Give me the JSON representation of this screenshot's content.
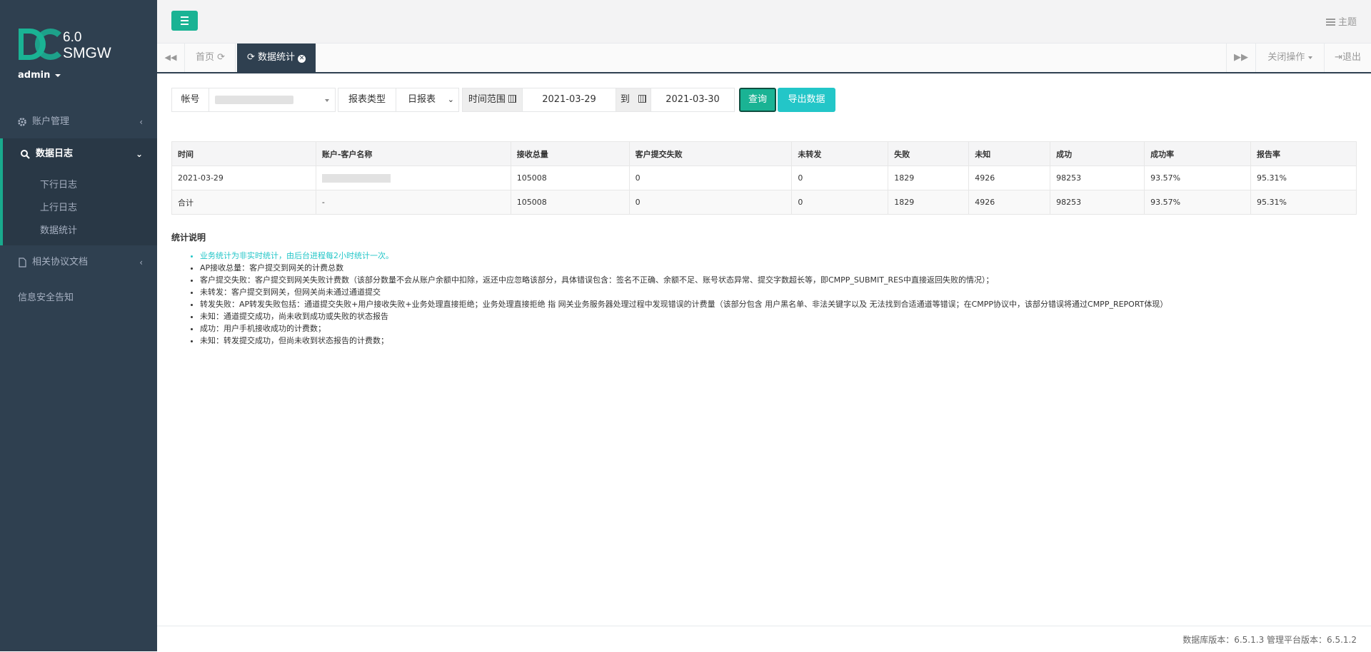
{
  "sidebar": {
    "logo_version": "6.0",
    "logo_product": "SMGW",
    "user": "admin",
    "menu": {
      "account": "账户管理",
      "data_log": "数据日志",
      "sub_down": "下行日志",
      "sub_up": "上行日志",
      "sub_stats": "数据统计",
      "docs": "相关协议文档",
      "security": "信息安全告知"
    }
  },
  "header": {
    "theme": "主题"
  },
  "tabs": {
    "home": "首页",
    "current": "数据统计",
    "close_ops": "关闭操作",
    "logout": "退出"
  },
  "filter": {
    "account_label": "帐号",
    "report_type_label": "报表类型",
    "report_type_value": "日报表",
    "time_range_label": "时间范围",
    "date_from": "2021-03-29",
    "to_label": "到",
    "date_to": "2021-03-30",
    "query_button": "查询",
    "export_button": "导出数据"
  },
  "table": {
    "headers": [
      "时间",
      "账户-客户名称",
      "接收总量",
      "客户提交失败",
      "未转发",
      "失败",
      "未知",
      "成功",
      "成功率",
      "报告率"
    ],
    "rows": [
      [
        "2021-03-29",
        "",
        "105008",
        "0",
        "0",
        "1829",
        "4926",
        "98253",
        "93.57%",
        "95.31%"
      ],
      [
        "合计",
        "-",
        "105008",
        "0",
        "0",
        "1829",
        "4926",
        "98253",
        "93.57%",
        "95.31%"
      ]
    ]
  },
  "notes": {
    "title": "统计说明",
    "items": [
      "业务统计为非实时统计，由后台进程每2小时统计一次。",
      "AP接收总量：客户提交到网关的计费总数",
      "客户提交失败：客户提交到网关失败计费数（该部分数量不会从账户余额中扣除，返还中应忽略该部分，具体错误包含：签名不正确、余额不足、账号状态异常、提交字数超长等，即CMPP_SUBMIT_RES中直接返回失败的情况）；",
      "未转发：客户提交到网关，但网关尚未通过通道提交",
      "转发失败：AP转发失败包括：通道提交失败+用户接收失败+业务处理直接拒绝；业务处理直接拒绝 指 网关业务服务器处理过程中发现错误的计费量（该部分包含 用户黑名单、非法关键字以及 无法找到合适通道等错误；在CMPP协议中，该部分错误将通过CMPP_REPORT体现）",
      "未知：通道提交成功，尚未收到成功或失败的状态报告",
      "成功：用户手机接收成功的计费数；",
      "未知：转发提交成功，但尚未收到状态报告的计费数；"
    ]
  },
  "footer": {
    "version_text": "数据库版本：6.5.1.3 管理平台版本：6.5.1.2"
  },
  "colors": {
    "sidebar_bg": "#2f4050",
    "accent_green": "#1ab394",
    "accent_cyan": "#23c6c8"
  }
}
